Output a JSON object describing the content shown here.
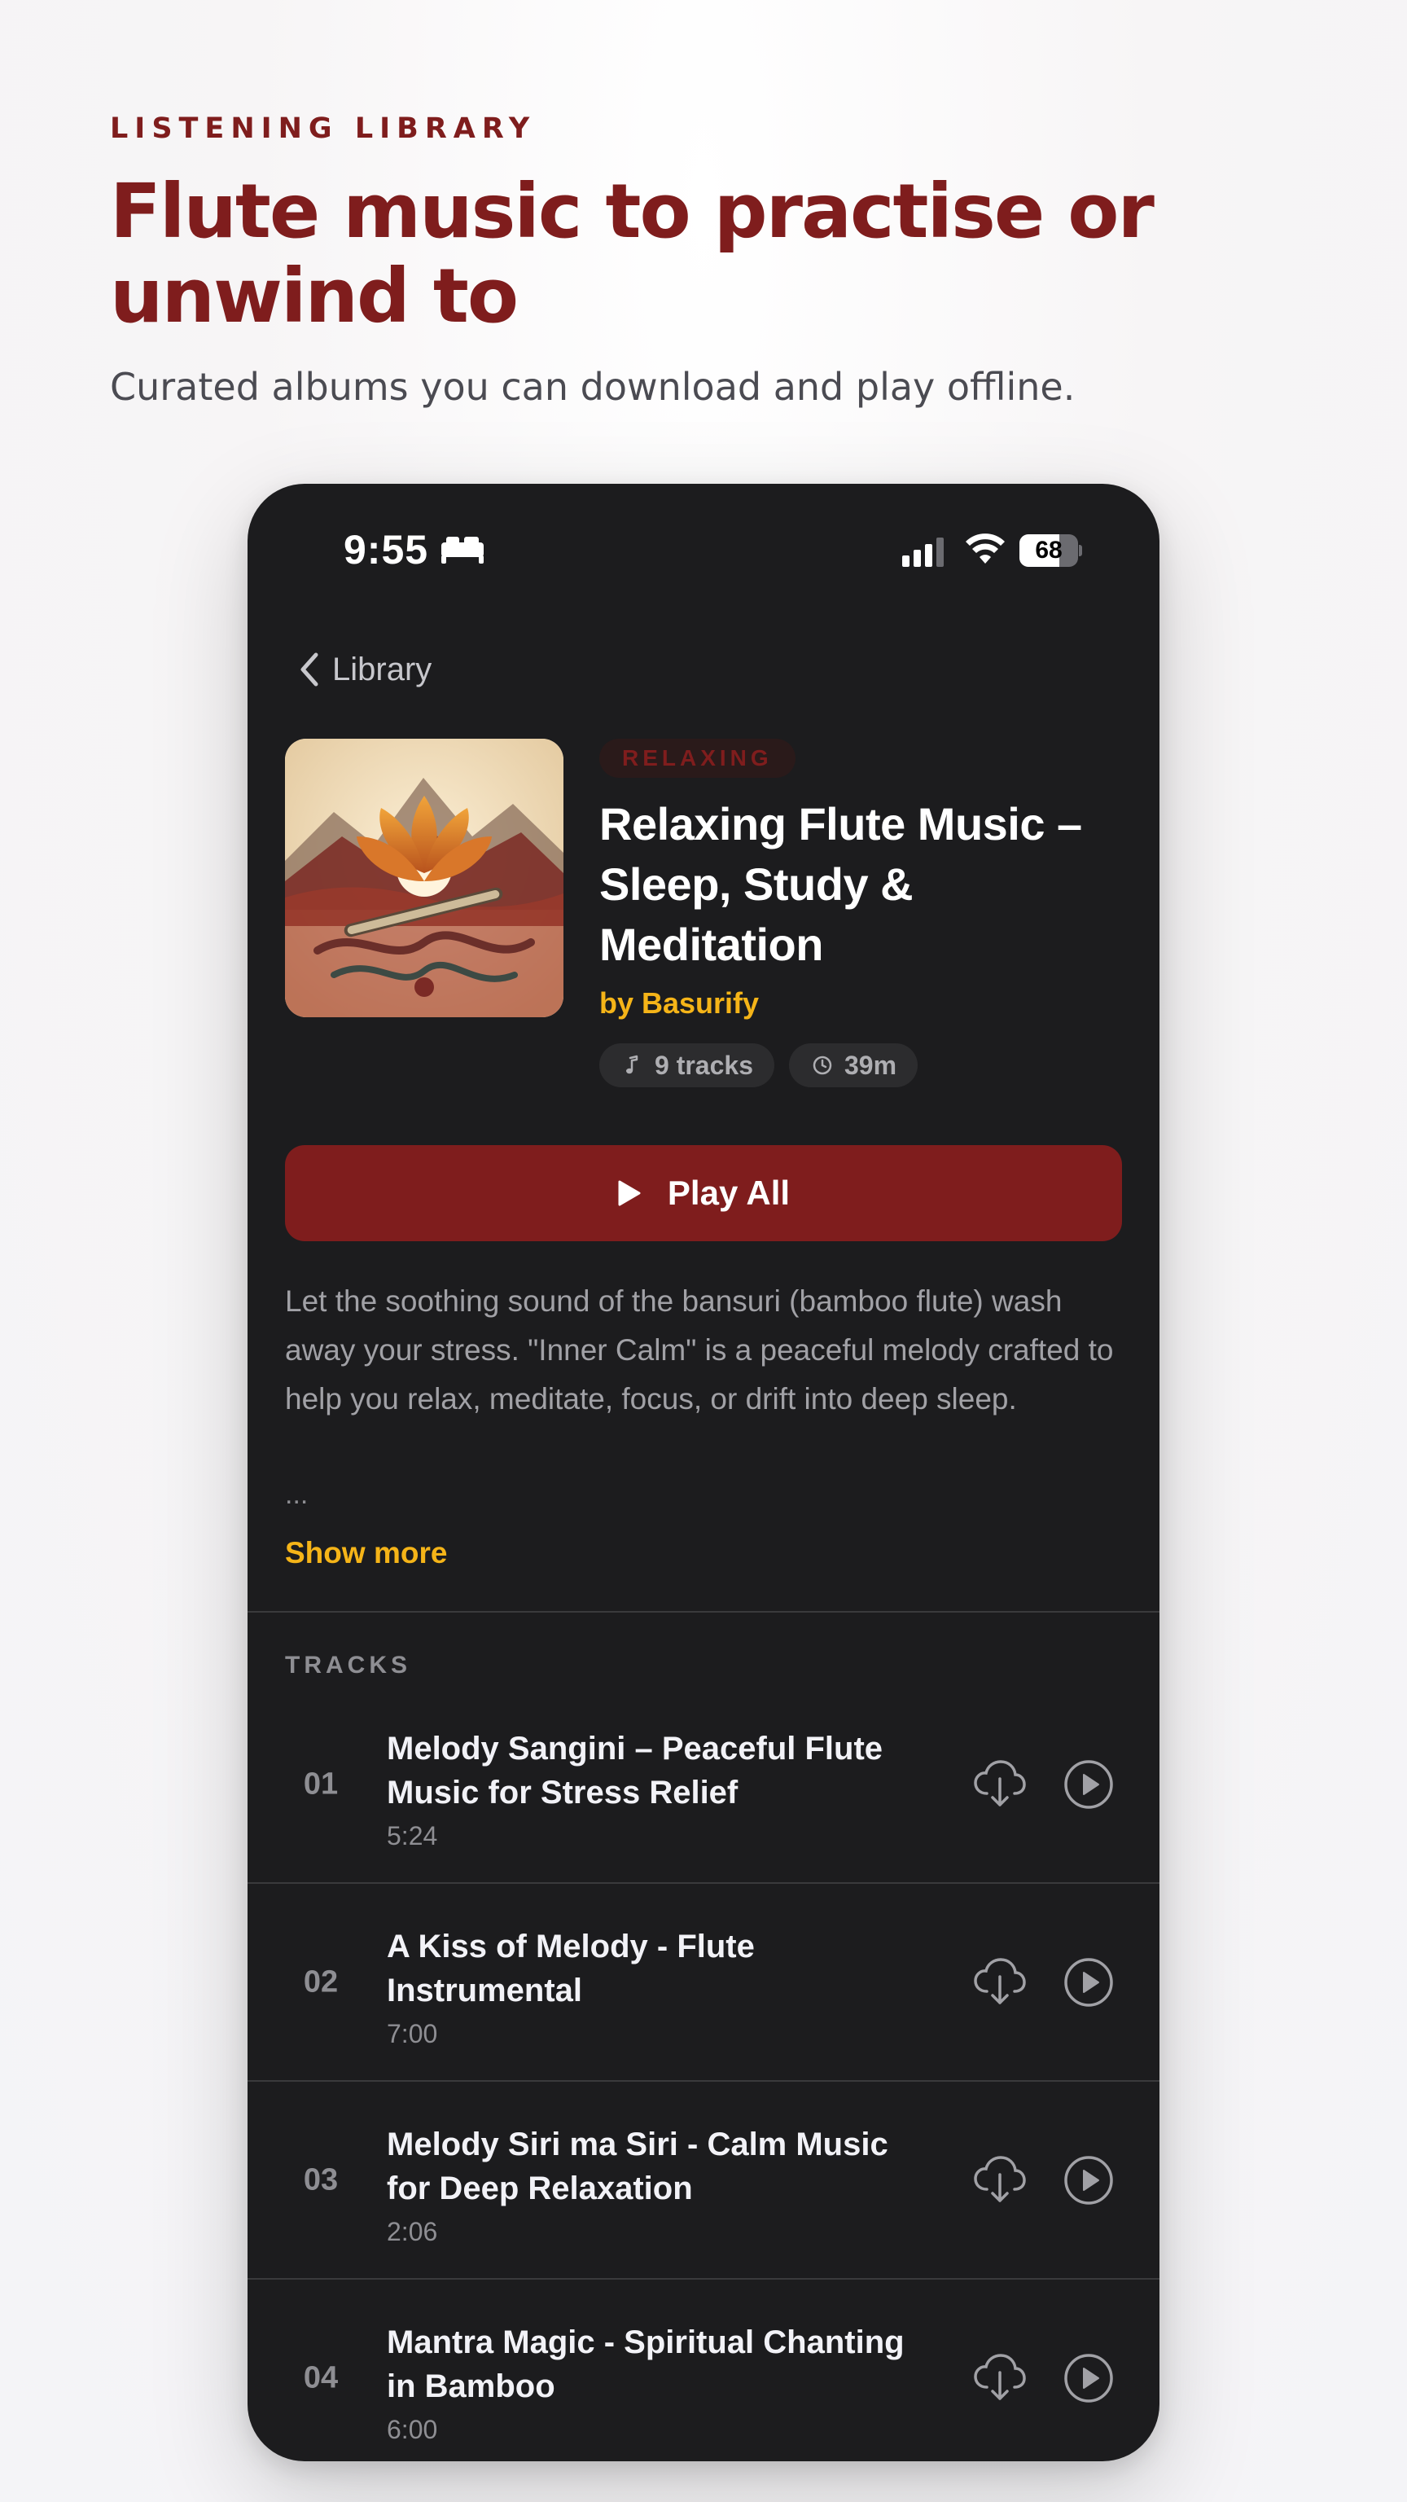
{
  "header": {
    "eyebrow": "LISTENING LIBRARY",
    "title": "Flute music to practise or unwind to",
    "subtitle": "Curated albums you can download and play offline."
  },
  "status_bar": {
    "time": "9:55",
    "battery": "68",
    "battery_level": 0.68,
    "icons": [
      "bed-icon",
      "signal-icon",
      "wifi-icon",
      "battery-icon"
    ]
  },
  "nav": {
    "back_label": "Library"
  },
  "album": {
    "badge": "RELAXING",
    "title": "Relaxing Flute Music – Sleep, Study & Meditation",
    "artist": "by Basurify",
    "tracks_count": "9 tracks",
    "duration": "39m",
    "play_all_label": "Play All",
    "description": "Let the soothing sound of the bansuri (bamboo flute) wash away your stress. \"Inner Calm\" is a peaceful melody crafted to help you relax, meditate, focus, or drift into deep sleep.",
    "ellipsis": "...",
    "show_more_label": "Show more"
  },
  "tracks_section": {
    "header": "TRACKS",
    "tracks": [
      {
        "number": "01",
        "title": "Melody Sangini – Peaceful Flute Music for Stress Relief",
        "duration": "5:24"
      },
      {
        "number": "02",
        "title": "A Kiss of Melody - Flute Instrumental",
        "duration": "7:00"
      },
      {
        "number": "03",
        "title": "Melody Siri ma Siri - Calm Music for Deep Relaxation",
        "duration": "2:06"
      },
      {
        "number": "04",
        "title": "Mantra Magic - Spiritual Chanting in Bamboo",
        "duration": "6:00"
      }
    ]
  },
  "colors": {
    "brand_red": "#7f1d1d",
    "accent_gold": "#f5b418",
    "phone_bg": "#1c1c1e"
  }
}
